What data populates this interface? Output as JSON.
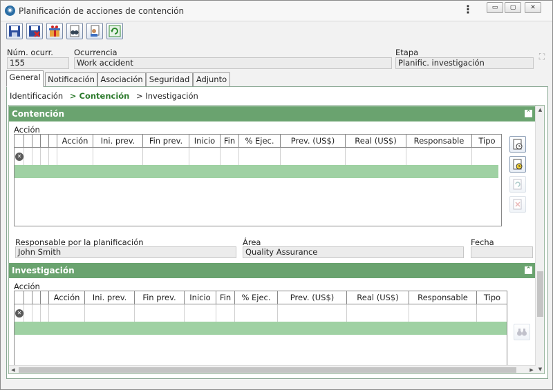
{
  "window": {
    "title": "Planificación de acciones de contención",
    "kebab": "⋮",
    "min": "▭",
    "max": "▢",
    "close": "✕"
  },
  "toolbar": {
    "buttons": [
      {
        "icon": "save-icon"
      },
      {
        "icon": "save-close-icon"
      },
      {
        "icon": "gift-icon"
      },
      {
        "icon": "binoculars-doc-icon"
      },
      {
        "icon": "user-doc-icon"
      },
      {
        "icon": "refresh-icon"
      }
    ]
  },
  "header": {
    "num_label": "Núm. ocurr.",
    "num_value": "155",
    "occurrence_label": "Ocurrencia",
    "occurrence_value": "Work accident",
    "stage_label": "Etapa",
    "stage_value": "Planific. investigación"
  },
  "tabs": [
    "General",
    "Notificación",
    "Asociación",
    "Seguridad",
    "Adjunto"
  ],
  "steps": {
    "step1": "Identificación",
    "step2": "> Contención",
    "step3": "> Investigación"
  },
  "containment": {
    "title": "Contención",
    "collapse": "⌃",
    "action_label": "Acción",
    "columns": [
      "Acción",
      "Ini. prev.",
      "Fin prev.",
      "Inicio",
      "Fin",
      "% Ejec.",
      "Prev. (US$)",
      "Real (US$)",
      "Responsable",
      "Tipo"
    ],
    "resp_label": "Responsable por la planificación",
    "resp_value": "John Smith",
    "area_label": "Área",
    "area_value": "Quality Assurance",
    "date_label": "Fecha",
    "date_value": ""
  },
  "investigation": {
    "title": "Investigación",
    "collapse": "⌃",
    "action_label": "Acción",
    "columns": [
      "Acción",
      "Ini. prev.",
      "Fin prev.",
      "Inicio",
      "Fin",
      "% Ejec.",
      "Prev. (US$)",
      "Real (US$)",
      "Responsable",
      "Tipo"
    ]
  },
  "marks": {
    "delete": "✕",
    "up": "▲",
    "down": "▼",
    "left": "◀",
    "right": "▶",
    "search": "⛶"
  },
  "colors": {
    "section": "#6aa36f",
    "selected_row": "#9fd1a3",
    "current_step": "#2c7a2c"
  }
}
